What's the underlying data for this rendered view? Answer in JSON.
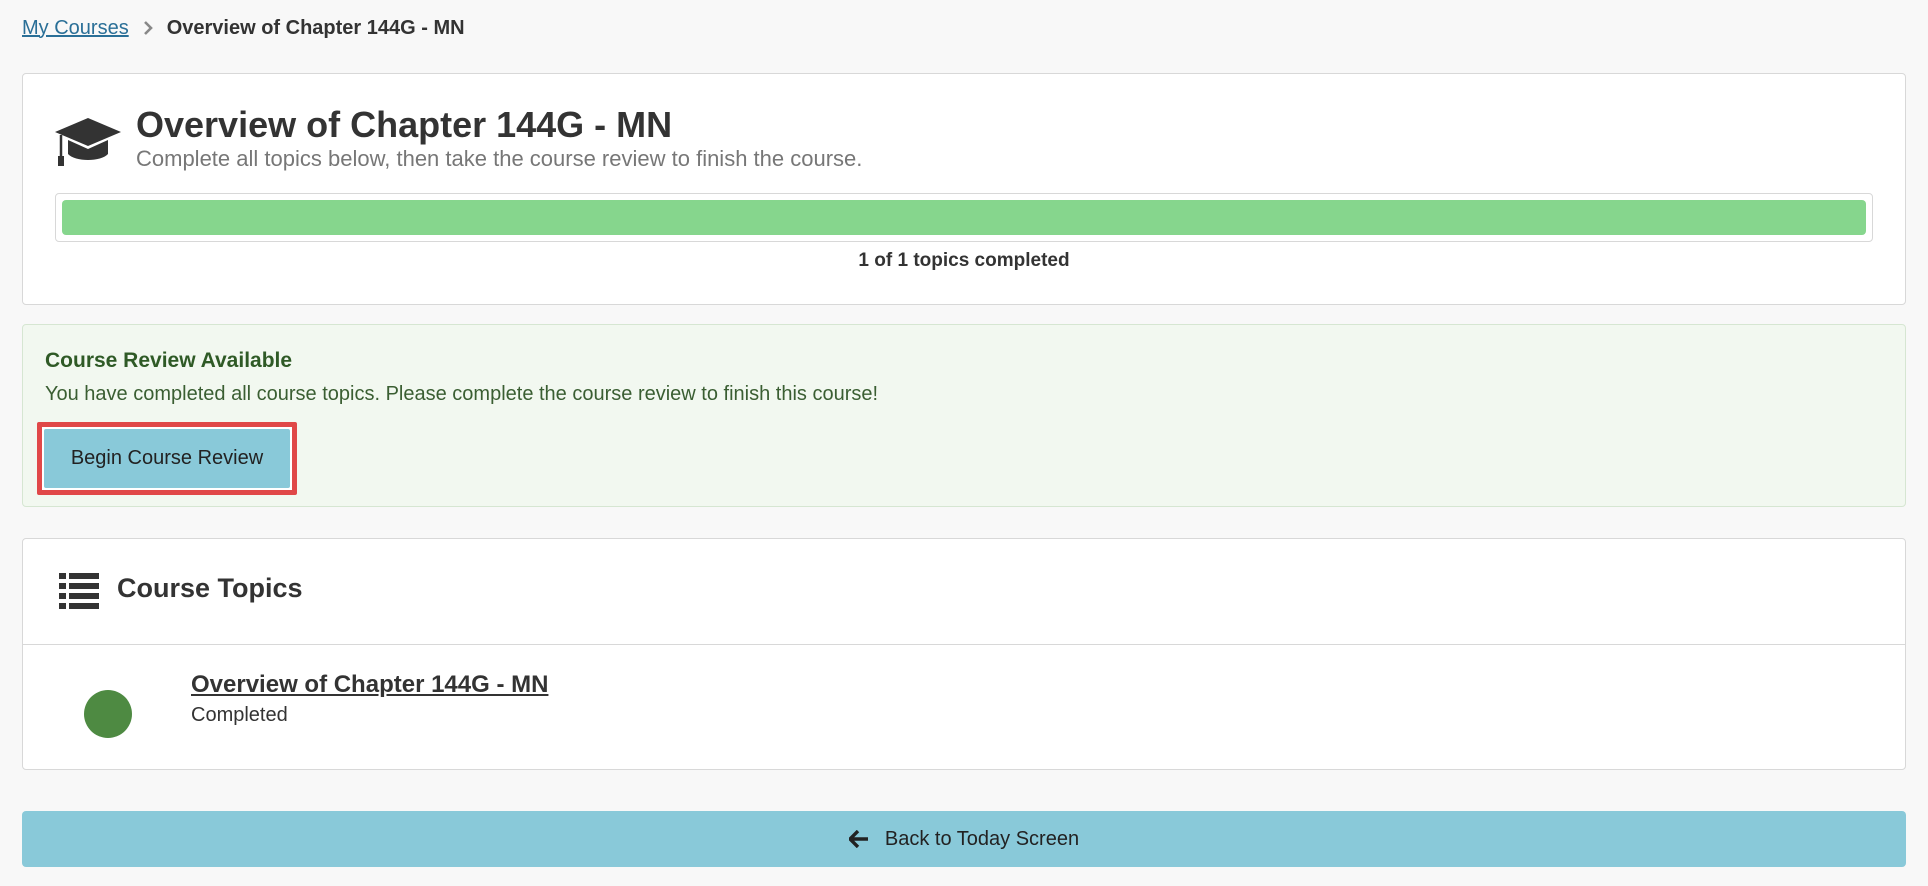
{
  "breadcrumb": {
    "parent": "My Courses",
    "current": "Overview of Chapter 144G - MN"
  },
  "overview": {
    "icon": "graduation-cap-icon",
    "title": "Overview of Chapter 144G - MN",
    "subtitle": "Complete all topics below, then take the course review to finish the course.",
    "progress_fraction": 1.0,
    "progress_text": "1 of 1 topics completed"
  },
  "review": {
    "title": "Course Review Available",
    "message": "You have completed all course topics. Please complete the course review to finish this course!",
    "button_label": "Begin Course Review"
  },
  "topics": {
    "icon": "list-icon",
    "title": "Course Topics",
    "items": [
      {
        "name": "Overview of Chapter 144G - MN",
        "status": "Completed",
        "status_color": "#4e8a42"
      }
    ]
  },
  "footer": {
    "back_icon": "arrow-left-icon",
    "back_label": "Back to Today Screen"
  },
  "colors": {
    "accent": "#89c9d9",
    "progress": "#86d68d",
    "highlight_border": "#e04848"
  }
}
